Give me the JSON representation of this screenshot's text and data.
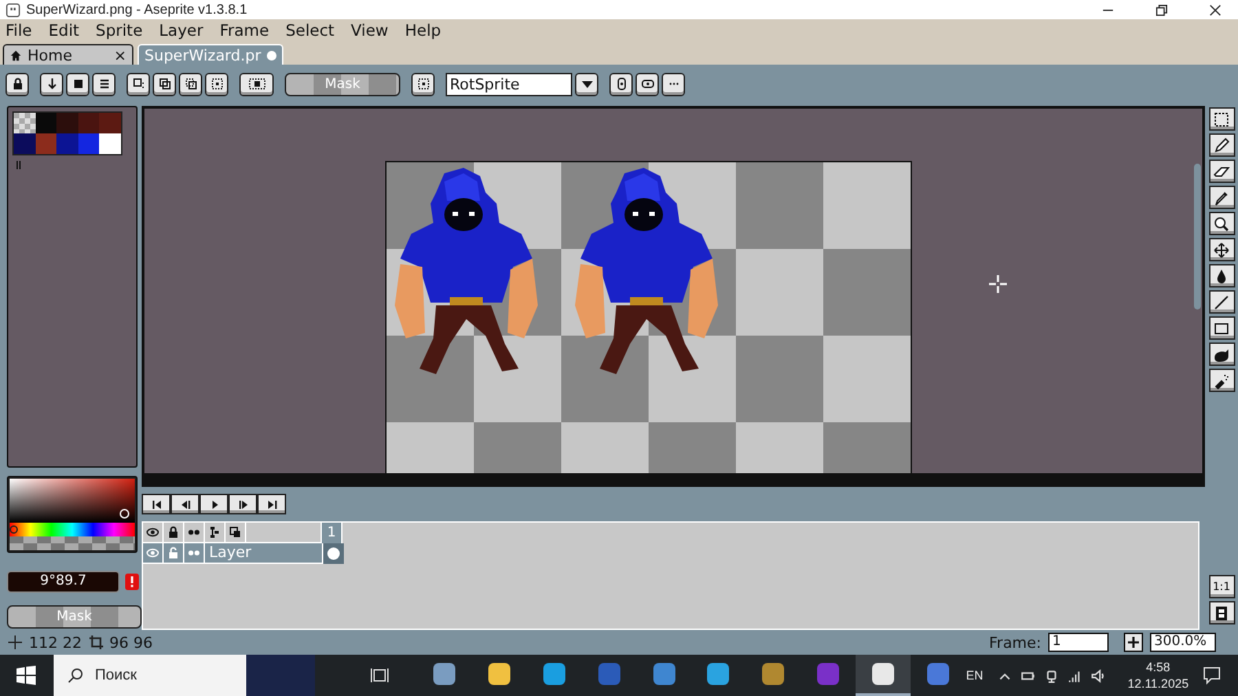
{
  "window": {
    "title": "SuperWizard.png - Aseprite v1.3.8.1"
  },
  "menu": [
    "File",
    "Edit",
    "Sprite",
    "Layer",
    "Frame",
    "Select",
    "View",
    "Help"
  ],
  "tabs": [
    {
      "label": "Home",
      "selected": false,
      "close": "×",
      "modified": false
    },
    {
      "label": "SuperWizard.pr",
      "selected": true,
      "modified": true
    }
  ],
  "toolbar": {
    "mask_button": "Mask",
    "resize_method": "RotSprite"
  },
  "palette": [
    {
      "kind": "transparent"
    },
    {
      "color": "#0a0a0a"
    },
    {
      "color": "#2c0e0c"
    },
    {
      "color": "#4a1410"
    },
    {
      "color": "#5c1a12"
    },
    {
      "color": "#0c0c5c"
    },
    {
      "color": "#8c2c1c"
    },
    {
      "color": "#0c1494"
    },
    {
      "color": "#1426e0"
    },
    {
      "color": "#ffffff"
    }
  ],
  "color_entry": {
    "value": "9°89.7",
    "warning": true
  },
  "mask_button": "Mask",
  "timeline": {
    "frames": [
      {
        "label": "1",
        "selected": true
      }
    ],
    "layers": [
      {
        "name": "Layer",
        "selected": true,
        "visible": true,
        "locked": false
      }
    ]
  },
  "zoom_actual_size": "1:1",
  "status_bar": {
    "position": "112 22",
    "size": "96 96",
    "frame_label": "Frame:",
    "frame": "1",
    "zoom": "300.0%"
  },
  "taskbar": {
    "search_placeholder": "Поиск",
    "apps": [
      {
        "color": "#7a9cc0",
        "active": false
      },
      {
        "color": "#f0c040",
        "active": false
      },
      {
        "color": "#1a9ee0",
        "active": false
      },
      {
        "color": "#2b5bb8",
        "active": false
      },
      {
        "color": "#3f86d0",
        "active": false
      },
      {
        "color": "#2aa3e0",
        "active": false
      },
      {
        "color": "#b08830",
        "active": false
      },
      {
        "color": "#7a30c8",
        "active": false
      },
      {
        "color": "#e8e8e8",
        "active": true
      },
      {
        "color": "#4a78d8",
        "active": false
      }
    ],
    "language": "EN",
    "time": "4:58",
    "date": "12.11.2025"
  }
}
